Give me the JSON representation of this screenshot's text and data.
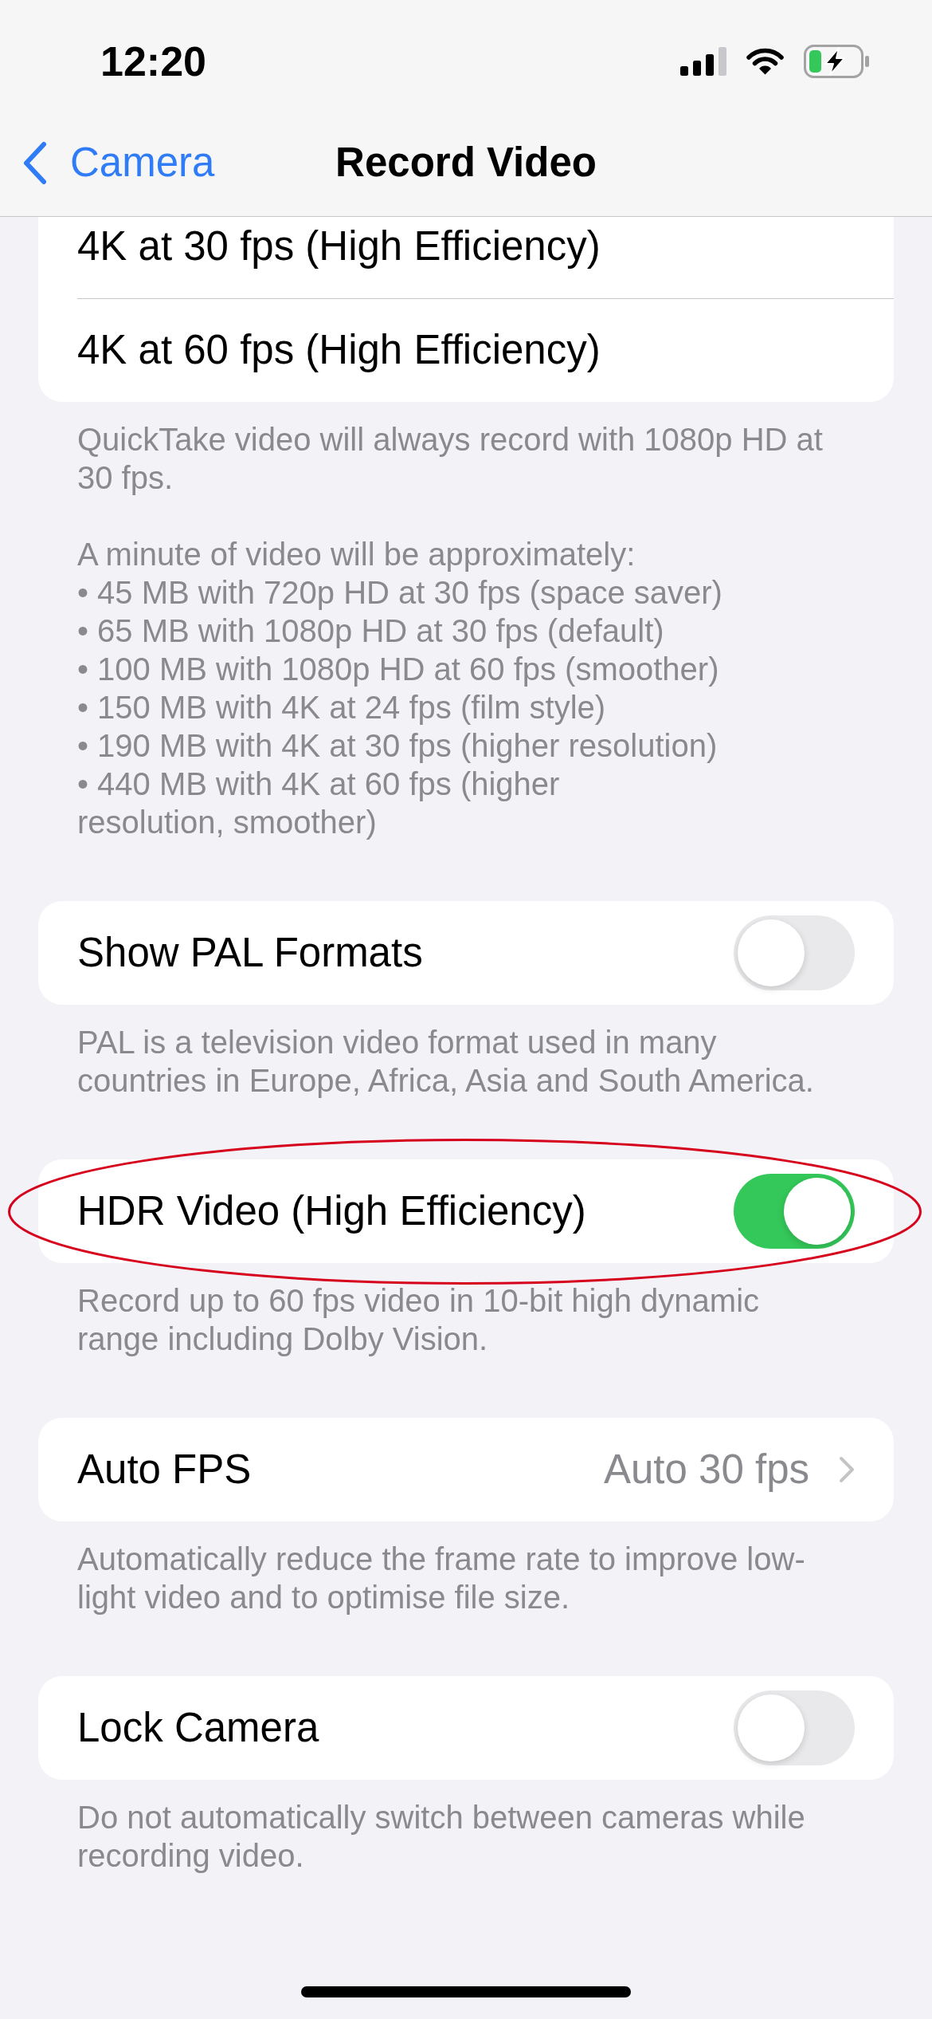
{
  "status_bar": {
    "time": "12:20"
  },
  "nav_bar": {
    "back": "Camera",
    "title": "Record Video"
  },
  "sections": [
    {
      "rows": [
        {
          "kind": "option",
          "label": "4K at 30 fps (High Efficiency)",
          "selected": false,
          "highlighted": false
        },
        {
          "kind": "option",
          "label": "4K at 60 fps (High Efficiency)",
          "selected": false,
          "highlighted": false
        }
      ],
      "footer": [
        {
          "kind": "paragraph",
          "text": "QuickTake video will always record with 1080p HD at 30 fps."
        },
        {
          "kind": "list",
          "title": "A minute of video will be approximately:",
          "items": [
            "• 45 MB with 720p HD at 30 fps (space saver)",
            "• 65 MB with 1080p HD at 30 fps (default)",
            "• 100 MB with 1080p HD at 60 fps (smoother)",
            "• 150 MB with 4K at 24 fps (film style)",
            "• 190 MB with 4K at 30 fps (higher resolution)",
            "• 440 MB with 4K at 60 fps (higher\nresolution, smoother)"
          ]
        }
      ]
    },
    {
      "rows": [
        {
          "kind": "toggle",
          "label": "Show PAL Formats",
          "on": false,
          "highlighted": false
        }
      ],
      "footer": [
        {
          "kind": "paragraph",
          "text": "PAL is a television video format used in many countries in Europe, Africa, Asia and South America."
        }
      ]
    },
    {
      "rows": [
        {
          "kind": "toggle",
          "label": "HDR Video (High Efficiency)",
          "on": true,
          "highlighted": true
        }
      ],
      "footer": [
        {
          "kind": "paragraph",
          "text": "Record up to 60 fps video in 10-bit high dynamic range including Dolby Vision."
        }
      ]
    },
    {
      "rows": [
        {
          "kind": "link",
          "label": "Auto FPS",
          "value": "Auto 30 fps",
          "highlighted": false
        }
      ],
      "footer": [
        {
          "kind": "paragraph",
          "text": "Automatically reduce the frame rate to improve low-light video and to optimise file size."
        }
      ]
    },
    {
      "rows": [
        {
          "kind": "toggle",
          "label": "Lock Camera",
          "on": false,
          "highlighted": false
        }
      ],
      "footer": [
        {
          "kind": "paragraph",
          "text": "Do not automatically switch between cameras while recording video."
        }
      ]
    }
  ]
}
